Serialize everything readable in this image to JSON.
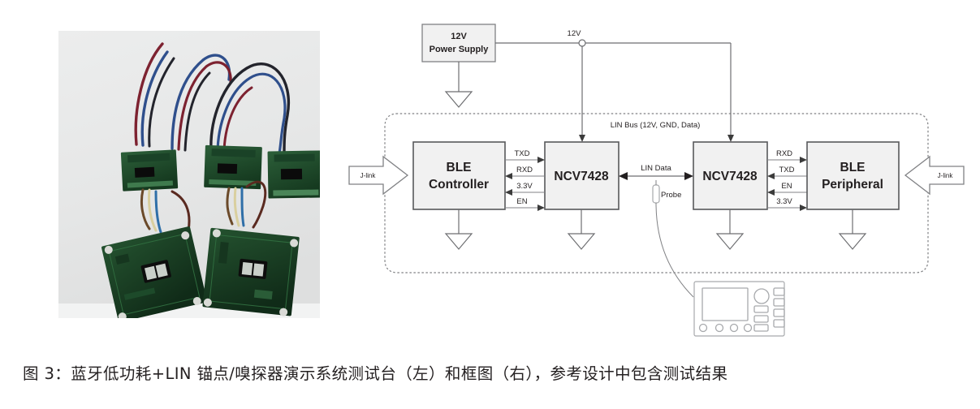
{
  "caption": {
    "text": "图 3：蓝牙低功耗+LIN 锚点/嗅探器演示系统测试台（左）和框图（右），参考设计中包含测试结果"
  },
  "photo": {
    "alt_label": "BLE + LIN anchor/sniffer demo system testbench photo",
    "board_count_small": 3,
    "board_count_large": 2,
    "background_color": "#e9eaea",
    "pcb_color": "#1f5130",
    "wire_colors": [
      "#8c2230",
      "#2b4d8e",
      "#1a1a22"
    ]
  },
  "diagram": {
    "power_supply": {
      "line1": "12V",
      "line2": "Power Supply"
    },
    "rail_label": "12V",
    "bus_label": "LIN Bus (12V, GND, Data)",
    "blocks": [
      {
        "id": "ble-controller",
        "line1": "BLE",
        "line2": "Controller"
      },
      {
        "id": "ncv7428-left",
        "line1": "NCV7428",
        "line2": ""
      },
      {
        "id": "ncv7428-right",
        "line1": "NCV7428",
        "line2": ""
      },
      {
        "id": "ble-peripheral",
        "line1": "BLE",
        "line2": "Peripheral"
      }
    ],
    "left_signals": [
      "TXD",
      "RXD",
      "3.3V",
      "EN"
    ],
    "right_signals": [
      "RXD",
      "TXD",
      "EN",
      "3.3V"
    ],
    "lin_data_label": "LIN Data",
    "probe_label": "Probe",
    "jlink_left_label": "J-link",
    "jlink_right_label": "J-link",
    "oscilloscope_label": "oscilloscope"
  }
}
